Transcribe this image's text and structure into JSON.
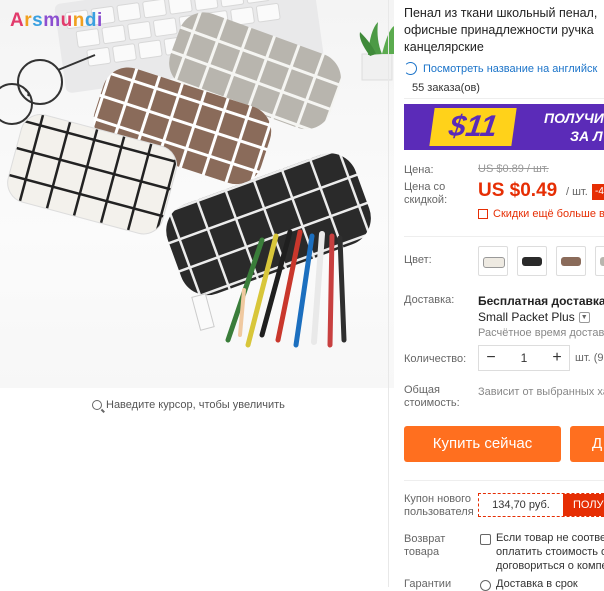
{
  "gallery": {
    "brand": "Arsmundi",
    "zoom_hint": "Наведите курсор, чтобы увеличить"
  },
  "product": {
    "title_lines": [
      "Пенал из ткани школьный пенал,",
      "офисные принадлежности ручка",
      "канцелярские"
    ],
    "translate_link": "Посмотреть название на английск",
    "orders": "55 заказа(ов)"
  },
  "banner": {
    "amount": "$11",
    "line1": "ПОЛУЧИ",
    "line2": "ЗА Л"
  },
  "price": {
    "label": "Цена:",
    "old": "US $0.89 / шт.",
    "discount_label": "Цена со скидкой:",
    "current": "US $0.49",
    "unit": "/ шт.",
    "badge": "-4",
    "promo": "Скидки ещё больше в"
  },
  "color": {
    "label": "Цвет:",
    "swatches": [
      "white",
      "black",
      "brown",
      "gray"
    ]
  },
  "shipping": {
    "label": "Доставка:",
    "main": "Бесплатная доставка в",
    "method": "Small Packet Plus",
    "estimate": "Расчётное время доставк"
  },
  "quantity": {
    "label": "Количество:",
    "minus": "−",
    "value": "1",
    "plus": "+",
    "unit": "шт. (9"
  },
  "total": {
    "label": "Общая стоимость:",
    "value": "Зависит от выбранных ха"
  },
  "actions": {
    "buy_now": "Купить сейчас",
    "add_cart": "Д"
  },
  "coupon": {
    "label": "Купон нового пользователя",
    "amount": "134,70 руб.",
    "get": "ПОЛУ"
  },
  "returns": {
    "label": "Возврат товара",
    "lines": [
      "Если товар не соответ",
      "оплатить стоимость об",
      "договориться о компе"
    ]
  },
  "guarantee": {
    "label": "Гарантии",
    "text": "Доставка в срок"
  },
  "colors": {
    "accent": "#e62e04",
    "button": "#ff6f1f",
    "link": "#1a73c9",
    "banner_bg": "#5b2bb8",
    "banner_yellow": "#ffd21a"
  }
}
